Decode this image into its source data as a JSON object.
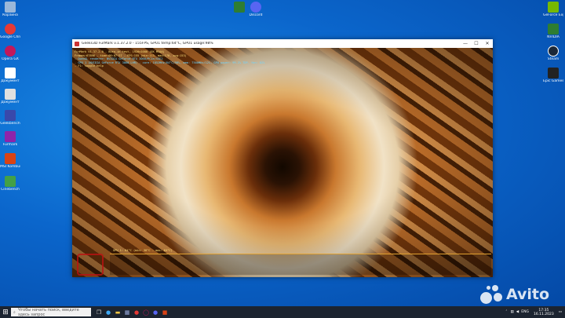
{
  "desktop_left": [
    {
      "label": "Корзина",
      "color": "#9ab7d9"
    },
    {
      "label": "Google Chrome",
      "color": "#e53935"
    },
    {
      "label": "Opera GX",
      "color": "#c2185b"
    },
    {
      "label": "Документ",
      "color": "#ffffff"
    },
    {
      "label": "Документ",
      "color": "#e0e0e0"
    },
    {
      "label": "Geekbench",
      "color": "#3949ab"
    },
    {
      "label": "Furmark",
      "color": "#8e24aa"
    },
    {
      "label": "MSI Kombustor",
      "color": "#d84315"
    },
    {
      "label": "Cinebench",
      "color": "#43a047"
    }
  ],
  "desktop_top": [
    {
      "label": "",
      "color": "#2e7d32"
    },
    {
      "label": "Discord",
      "color": "#5865f2"
    }
  ],
  "desktop_right": [
    {
      "label": "GeForce Experience",
      "color": "#76b900"
    },
    {
      "label": "NVIDIA",
      "color": "#2e7d32"
    },
    {
      "label": "Steam",
      "color": "#1b2838"
    },
    {
      "label": "Epic Games Launcher",
      "color": "#222222"
    }
  ],
  "window": {
    "title": "Geeks3D FurMark v.1.37.2.0 - 155FPS, GPU1 temp:64°C, GPU1 usage:98%",
    "min": "—",
    "max": "☐",
    "close": "✕"
  },
  "osd": {
    "line1": "FurMark v1.37.2.0 - Burn-in test, 1920x1080 (0X MSAA)",
    "line2": "Frames:67896 - time:00:07:27 - FPS:155 (min:113, max:170, avg:153)",
    "line3": "- OpenGL renderer: NVIDIA GeForce RTX 3060/PCIe/SSE2",
    "line4": "- GPU 1 (NVIDIA GeForce RTX 3060 LHR) - core: 1852MHz/64°C/98%, mem: 7500MHz/12%, GPU power: 99.2% TDP, fan: 62%",
    "line5": "- F1: toggle help",
    "graph_label": "GPU 1: 64°C (min: 38°C - max: 64°C)"
  },
  "taskbar": {
    "search_placeholder": "Чтобы начать поиск, введите здесь запрос",
    "lang": "ENG",
    "time": "17:35",
    "date": "16.11.2023"
  },
  "watermark": "Avito"
}
